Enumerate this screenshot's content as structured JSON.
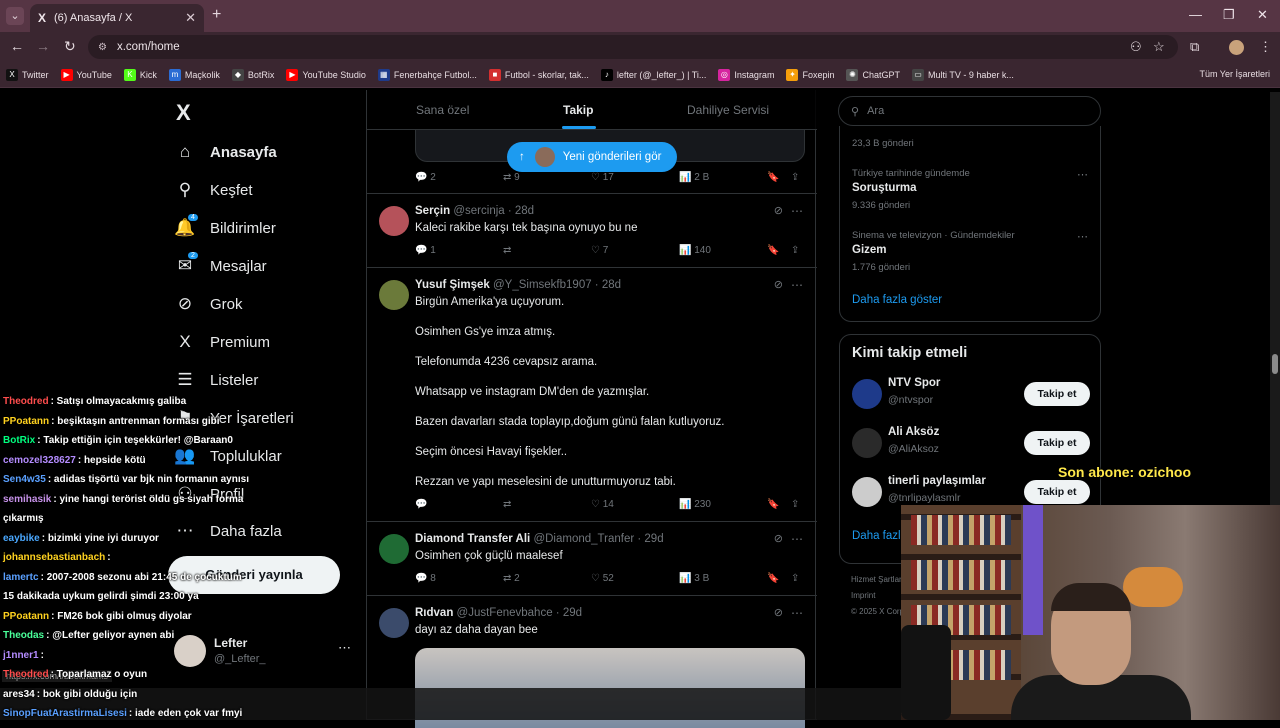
{
  "browser": {
    "tab_title": "(6) Anasayfa / X",
    "url": "x.com/home",
    "bookmarks": [
      {
        "label": "Twitter",
        "color": "#111111",
        "glyph": "X"
      },
      {
        "label": "YouTube",
        "color": "#ff0000",
        "glyph": "▶"
      },
      {
        "label": "Kick",
        "color": "#53fc18",
        "glyph": "K"
      },
      {
        "label": "Maçkolik",
        "color": "#2b6cd4",
        "glyph": "m"
      },
      {
        "label": "BotRix",
        "color": "#444444",
        "glyph": "◆"
      },
      {
        "label": "YouTube Studio",
        "color": "#ff0000",
        "glyph": "▶"
      },
      {
        "label": "Fenerbahçe Futbol...",
        "color": "#1e3a8a",
        "glyph": "▦"
      },
      {
        "label": "Futbol - skorlar, tak...",
        "color": "#d32f2f",
        "glyph": "■"
      },
      {
        "label": "lefter (@_lefter_) | Ti...",
        "color": "#000000",
        "glyph": "♪"
      },
      {
        "label": "Instagram",
        "color": "#d6249f",
        "glyph": "◎"
      },
      {
        "label": "Foxepin",
        "color": "#f59e0b",
        "glyph": "✦"
      },
      {
        "label": "ChatGPT",
        "color": "#555555",
        "glyph": "✺"
      },
      {
        "label": "Multi TV - 9 haber k...",
        "color": "#444444",
        "glyph": "▭"
      }
    ],
    "all_bookmarks": "Tüm Yer İşaretleri"
  },
  "nav": {
    "items": [
      {
        "label": "Anasayfa",
        "icon": "⌂"
      },
      {
        "label": "Keşfet",
        "icon": "⚲"
      },
      {
        "label": "Bildirimler",
        "icon": "🔔",
        "badge": "4"
      },
      {
        "label": "Mesajlar",
        "icon": "✉",
        "badge": "2"
      },
      {
        "label": "Grok",
        "icon": "⊘"
      },
      {
        "label": "Premium",
        "icon": "X"
      },
      {
        "label": "Listeler",
        "icon": "☰"
      },
      {
        "label": "Yer İşaretleri",
        "icon": "⚑"
      },
      {
        "label": "Topluluklar",
        "icon": "👥"
      },
      {
        "label": "Profil",
        "icon": "⚇"
      },
      {
        "label": "Daha fazla",
        "icon": "⋯"
      }
    ],
    "post_button": "Gönderi yayınla",
    "account": {
      "name": "Lefter",
      "handle": "@_Lefter_"
    }
  },
  "timeline": {
    "tabs": [
      "Sana özel",
      "Takip",
      "Dahiliye Servisi"
    ],
    "new_posts": "Yeni gönderileri gör",
    "first_actions": {
      "replies": "2",
      "reposts": "9",
      "likes": "17",
      "views": "2 B"
    },
    "tweets": [
      {
        "name": "Serçin",
        "handle": "@sercinja",
        "time": "28d",
        "text": [
          "Kaleci rakibe karşı tek başına oynuyo bu ne"
        ],
        "replies": "1",
        "reposts": "",
        "likes": "7",
        "views": "140",
        "avatar_color": "#b5525a"
      },
      {
        "name": "Yusuf Şimşek",
        "handle": "@Y_Simsekfb1907",
        "time": "28d",
        "text": [
          "Birgün Amerika'ya uçuyorum.",
          "Osimhen Gs'ye imza atmış.",
          "Telefonumda 4236 cevapsız arama.",
          "Whatsapp ve instagram DM'den de yazmışlar.",
          "Bazen davarları stada toplayıp,doğum günü falan kutluyoruz.",
          "Seçim öncesi Havayi fişekler..",
          "Rezzan ve yapı meselesini de unutturmuyoruz tabi."
        ],
        "replies": "",
        "reposts": "",
        "likes": "14",
        "views": "230",
        "avatar_color": "#6b7a3a"
      },
      {
        "name": "Diamond Transfer Ali",
        "handle": "@Diamond_Tranfer",
        "time": "29d",
        "text": [
          "Osimhen çok güçlü maalesef"
        ],
        "replies": "8",
        "reposts": "2",
        "likes": "52",
        "views": "3 B",
        "avatar_color": "#1f6b34"
      },
      {
        "name": "Rıdvan",
        "handle": "@JustFenevbahce",
        "time": "29d",
        "text": [
          "dayı az daha dayan bee"
        ],
        "replies": "",
        "reposts": "",
        "likes": "",
        "views": "",
        "avatar_color": "#3b4b6b"
      }
    ]
  },
  "right": {
    "search_placeholder": "Ara",
    "trends": [
      {
        "meta": "",
        "name": "",
        "count": "23,3 B gönderi"
      },
      {
        "meta": "Türkiye tarihinde gündemde",
        "name": "Soruşturma",
        "count": "9.336 gönderi"
      },
      {
        "meta": "Sinema ve televizyon · Gündemdekiler",
        "name": "Gizem",
        "count": "1.776 gönderi"
      }
    ],
    "show_more": "Daha fazla göster",
    "who_to_follow_title": "Kimi takip etmeli",
    "follow": [
      {
        "name": "NTV Spor",
        "handle": "@ntvspor",
        "color": "#1e3a8a"
      },
      {
        "name": "Ali Aksöz",
        "handle": "@AliAksoz",
        "color": "#2a2a2a"
      },
      {
        "name": "tinerli paylaşımlar",
        "handle": "@tnrlipaylasmlr",
        "color": "#cccccc"
      }
    ],
    "follow_button": "Takip et",
    "show_more_2": "Daha fazla göster",
    "footer": [
      "Hizmet Şartları",
      "Imprint",
      "© 2025 X Corp."
    ]
  },
  "chat": [
    {
      "user": "Theodred",
      "color": "#ff4d4d",
      "text": "Satışı olmayacakmış galiba"
    },
    {
      "user": "PPoatann",
      "color": "#ffd21f",
      "text": "beşiktaşın antrenman forması gibi"
    },
    {
      "user": "BotRix",
      "color": "#00ff7f",
      "text": "Takip ettiğin için teşekkürler! @Baraan0"
    },
    {
      "user": "cemozel328627",
      "color": "#b48cff",
      "text": "hepside kötü"
    },
    {
      "user": "Sen4w35",
      "color": "#5aa0ff",
      "text": "adidas tişörtü var bjk nin formanın aynısı"
    },
    {
      "user": "semihasik",
      "color": "#c792ea",
      "text": "yine hangi terörist öldü gs siyah forma"
    },
    {
      "user": "",
      "color": "#ffffff",
      "text": "çıkarmış"
    },
    {
      "user": "eaybike",
      "color": "#4aa8ff",
      "text": "bizimki yine iyi duruyor"
    },
    {
      "user": "johannsebastianbach",
      "color": "#ffd21f",
      "text": ""
    },
    {
      "user": "lamertc",
      "color": "#5aa0ff",
      "text": "2007-2008 sezonu abi 21:45 de çocuktum"
    },
    {
      "user": "",
      "color": "#ffffff",
      "text": "15 dakikada uykum gelirdi şimdi 23:00 ya"
    },
    {
      "user": "PPoatann",
      "color": "#ffd21f",
      "text": "FM26 bok gibi olmuş diyolar"
    },
    {
      "user": "Theodas",
      "color": "#4aff9a",
      "text": "@Lefter geliyor aynen abi"
    },
    {
      "user": "j1nner1",
      "color": "#b48cff",
      "text": ""
    },
    {
      "user": "Theodred",
      "color": "#ff4d4d",
      "text": "Toparlamaz o oyun"
    },
    {
      "user": "ares34",
      "color": "#ffffff",
      "text": "bok gibi olduğu için"
    },
    {
      "user": "SinopFuatArastirmaLisesi",
      "color": "#5aa0ff",
      "text": "iade eden çok var fmyi"
    }
  ],
  "overlay": {
    "subscriber": "Son abone: ozichoo"
  },
  "status_url": "https://x.com/i/bookmarks"
}
